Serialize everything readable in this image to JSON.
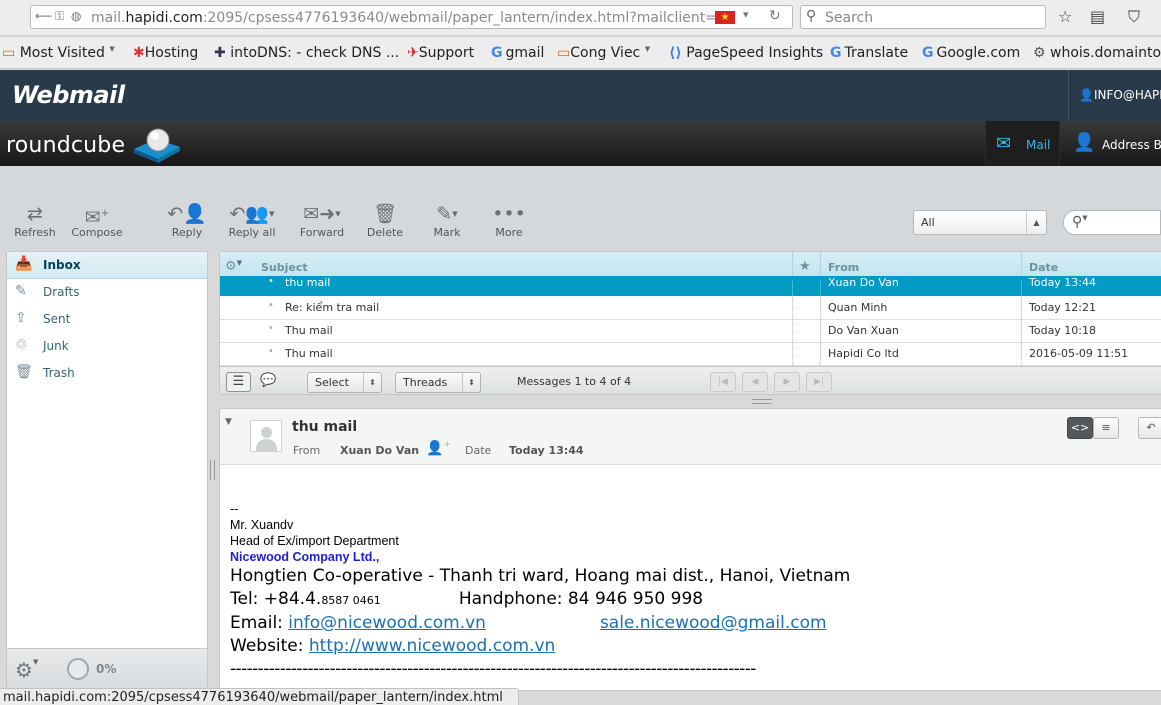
{
  "browser": {
    "url_prefix": "mail.",
    "url_domain": "hapidi.com",
    "url_rest": ":2095/cpsess4776193640/webmail/paper_lantern/index.html?mailclient=ro",
    "search_placeholder": "Search"
  },
  "bookmarks": [
    {
      "label": "Most Visited",
      "icon": "folder-icon",
      "dropdown": true
    },
    {
      "label": "Hosting",
      "icon": "hosting-icon"
    },
    {
      "label": "intoDNS: - check DNS ...",
      "icon": "dns-icon"
    },
    {
      "label": "Support",
      "icon": "support-icon"
    },
    {
      "label": "gmail",
      "icon": "google-icon"
    },
    {
      "label": "Cong Viec",
      "icon": "folder-icon",
      "dropdown": true
    },
    {
      "label": "PageSpeed Insights",
      "icon": "pagespeed-icon"
    },
    {
      "label": "Translate",
      "icon": "google-icon"
    },
    {
      "label": "Google.com",
      "icon": "google-icon"
    },
    {
      "label": "whois.domainto",
      "icon": "gear-icon"
    }
  ],
  "cpanel": {
    "logo": "Webmail",
    "user": "INFO@HAPIDI"
  },
  "roundcube": {
    "logo": "roundcube",
    "tabs": {
      "mail": "Mail",
      "addressbook": "Address B"
    }
  },
  "toolbar": {
    "refresh": "Refresh",
    "compose": "Compose",
    "reply": "Reply",
    "reply_all": "Reply all",
    "forward": "Forward",
    "delete": "Delete",
    "mark": "Mark",
    "more": "More",
    "filter": "All"
  },
  "folders": [
    {
      "label": "Inbox",
      "icon": "inbox-icon",
      "selected": true
    },
    {
      "label": "Drafts",
      "icon": "pencil-icon"
    },
    {
      "label": "Sent",
      "icon": "sent-icon"
    },
    {
      "label": "Junk",
      "icon": "junk-icon"
    },
    {
      "label": "Trash",
      "icon": "trash-icon"
    }
  ],
  "quota": "0%",
  "message_list": {
    "columns": {
      "subject": "Subject",
      "from": "From",
      "date": "Date"
    },
    "rows": [
      {
        "subject": "thu mail",
        "from": "Xuan Do Van",
        "date": "Today 13:44",
        "selected": true
      },
      {
        "subject": "Re: kiểm tra mail",
        "from": "Quan Minh",
        "date": "Today 12:21"
      },
      {
        "subject": "Thu mail",
        "from": "Do Van Xuan",
        "date": "Today 10:18"
      },
      {
        "subject": "Thu mail",
        "from": "Hapidi Co ltd",
        "date": "2016-05-09 11:51"
      }
    ],
    "select_label": "Select",
    "threads_label": "Threads",
    "count": "Messages 1 to 4 of 4"
  },
  "preview": {
    "subject": "thu mail",
    "from_label": "From",
    "from": "Xuan Do Van",
    "date_label": "Date",
    "date": "Today 13:44",
    "body": {
      "sig_sep": "--",
      "name": "Mr. Xuandv",
      "dept": "Head of Ex/import Department",
      "company": "Nicewood Company Ltd.,",
      "address": "Hongtien Co-operative - Thanh tri ward, Hoang mai dist., Hanoi, Vietnam",
      "tel_label": "Tel: +84.4.",
      "tel_small": "8587 0461",
      "handphone": "Handphone: 84 946 950 998",
      "email_label": "Email: ",
      "email1": "info@nicewood.com.vn",
      "email2": "sale.nicewood@gmail.com",
      "website_label": "Website: ",
      "website": "http://www.nicewood.com.vn",
      "rule": "-----------------------------------------------------------------------------------------------"
    }
  },
  "statusbar": "mail.hapidi.com:2095/cpsess4776193640/webmail/paper_lantern/index.html",
  "colors": {
    "header": "#293a4a",
    "selected_row": "#019bc6",
    "list_header": "#c2e2ee",
    "company": "#1f1fd8",
    "link": "#1c6fb2"
  }
}
